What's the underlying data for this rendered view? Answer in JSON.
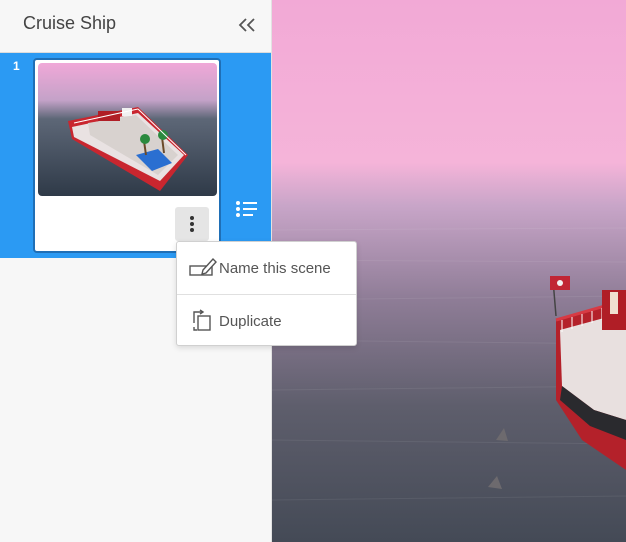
{
  "panel": {
    "title": "Cruise Ship",
    "collapse_icon": "double-chevron-left-icon"
  },
  "scenes": [
    {
      "number": "1",
      "thumbnail": "cruise-ship-scene-thumbnail",
      "selected": true
    }
  ],
  "menu": {
    "items": [
      {
        "label": "Name this scene",
        "icon": "rename-pencil-icon"
      },
      {
        "label": "Duplicate",
        "icon": "duplicate-icon"
      }
    ]
  },
  "colors": {
    "selection": "#2b9af3",
    "sky_top": "#f2a9d6",
    "sea": "#3f4652"
  }
}
